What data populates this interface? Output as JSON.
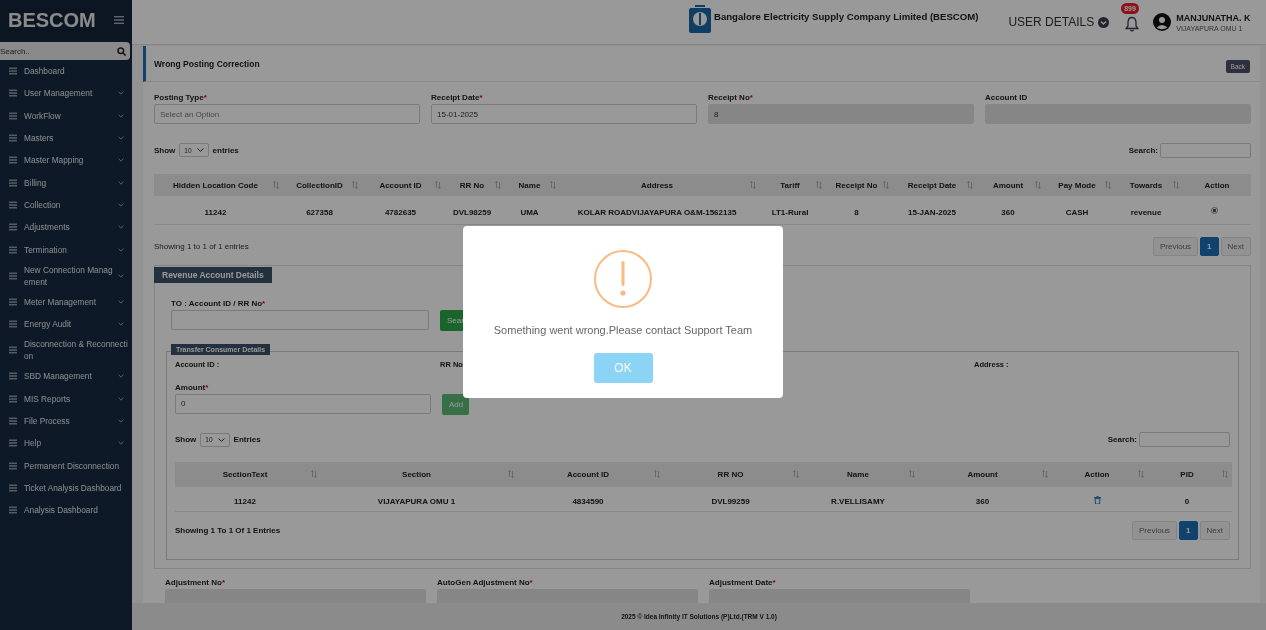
{
  "sidebar": {
    "brand": "BESCOM",
    "search": {
      "placeholder": "Search.."
    },
    "items": [
      {
        "label": "Dashboard",
        "expandable": false
      },
      {
        "label": "User Management",
        "expandable": true
      },
      {
        "label": "WorkFlow",
        "expandable": true
      },
      {
        "label": "Masters",
        "expandable": true
      },
      {
        "label": "Master Mapping",
        "expandable": true
      },
      {
        "label": "Billing",
        "expandable": true
      },
      {
        "label": "Collection",
        "expandable": true
      },
      {
        "label": "Adjustments",
        "expandable": true
      },
      {
        "label": "Termination",
        "expandable": true
      },
      {
        "label": "New Connection Management",
        "expandable": true
      },
      {
        "label": "Meter Management",
        "expandable": true
      },
      {
        "label": "Energy Audit",
        "expandable": true
      },
      {
        "label": "Disconnection & Reconnection",
        "expandable": false
      },
      {
        "label": "SBD Management",
        "expandable": true
      },
      {
        "label": "MIS Reports",
        "expandable": true
      },
      {
        "label": "File Process",
        "expandable": true
      },
      {
        "label": "Help",
        "expandable": true
      },
      {
        "label": "Permanent Disconnection",
        "expandable": false
      },
      {
        "label": "Ticket Analysis Dashboard",
        "expandable": false
      },
      {
        "label": "Analysis Dashboard",
        "expandable": false
      }
    ]
  },
  "header": {
    "company": "Bangalore Electricity Supply Company Limited (BESCOM)",
    "user_details": "USER DETAILS",
    "notification_count": "899",
    "user": {
      "name": "MANJUNATHA. K",
      "location": "VIJAYAPURA OMU 1"
    }
  },
  "page": {
    "title": "Wrong Posting Correction",
    "back_button": "Back",
    "fields": [
      {
        "label": "Posting Type",
        "required_mark": "*",
        "placeholder": "Select an Option",
        "disabled": false
      },
      {
        "label": "Receipt Date",
        "required_mark": "*",
        "value": "15-01-2025",
        "disabled": false
      },
      {
        "label": "Receipt No",
        "required_mark": "*",
        "value": "8",
        "disabled": true
      },
      {
        "label": "Account ID",
        "disabled": true
      }
    ],
    "receipts_table": {
      "length_menu": {
        "show": "Show",
        "value": "10",
        "entries": "entries"
      },
      "search_label": "Search:",
      "columns": [
        {
          "label": "Hidden Location Code",
          "sortable": true,
          "kind": "text"
        },
        {
          "label": "CollectionID",
          "sortable": true,
          "kind": "text"
        },
        {
          "label": "Account ID",
          "sortable": true,
          "kind": "text"
        },
        {
          "label": "RR No",
          "sortable": true,
          "kind": "text"
        },
        {
          "label": "Name",
          "sortable": true,
          "kind": "text"
        },
        {
          "label": "Address",
          "sortable": true,
          "kind": "text"
        },
        {
          "label": "Tariff",
          "sortable": true,
          "kind": "text"
        },
        {
          "label": "Receipt No",
          "sortable": true,
          "kind": "text"
        },
        {
          "label": "Receipt Date",
          "sortable": true,
          "kind": "text"
        },
        {
          "label": "Amount",
          "sortable": true,
          "kind": "text"
        },
        {
          "label": "Pay Mode",
          "sortable": true,
          "kind": "text"
        },
        {
          "label": "Towards",
          "sortable": true,
          "kind": "text"
        },
        {
          "label": "Action",
          "sortable": false,
          "kind": "action"
        }
      ],
      "rows": [
        {
          "cells": [
            "11242",
            "627358",
            "4782635",
            "DVL98259",
            "UMA",
            "KOLAR ROADVIJAYAPURA O&M-1562135",
            "LT1-Rural",
            "8",
            "15-JAN-2025",
            "360",
            "CASH",
            "revenue",
            ""
          ],
          "action": {
            "kind": "radio",
            "selected": true
          }
        }
      ],
      "info": "Showing 1 to 1 of 1 entries",
      "pagination": [
        {
          "label": "Previous",
          "selected": false,
          "disabled": true
        },
        {
          "label": "1",
          "selected": true,
          "disabled": false
        },
        {
          "label": "Next",
          "selected": false,
          "disabled": true
        }
      ]
    },
    "revenue": {
      "title": "Revenue Account Details",
      "to_field": {
        "label": "TO : Account ID / RR No",
        "required_mark": "*"
      },
      "search_button": "Sear",
      "transfer": {
        "title": "Transfer Consumer Details",
        "info": [
          {
            "label": "Account ID :"
          },
          {
            "label": "RR No"
          },
          {
            "label": "Address :"
          }
        ],
        "amount_field": {
          "label": "Amount",
          "required_mark": "*",
          "value": "0"
        },
        "add_button": "Add",
        "table": {
          "length_menu": {
            "show": "Show",
            "value": "10",
            "entries": "Entries"
          },
          "search_label": "Search:",
          "columns": [
            {
              "label": "SectionText",
              "sortable": true,
              "kind": "text"
            },
            {
              "label": "Section",
              "sortable": true,
              "kind": "text"
            },
            {
              "label": "Account ID",
              "sortable": true,
              "kind": "text"
            },
            {
              "label": "RR NO",
              "sortable": true,
              "kind": "text"
            },
            {
              "label": "Name",
              "sortable": true,
              "kind": "text"
            },
            {
              "label": "Amount",
              "sortable": true,
              "kind": "text"
            },
            {
              "label": "Action",
              "sortable": true,
              "kind": "action"
            },
            {
              "label": "PID",
              "sortable": true,
              "kind": "text"
            }
          ],
          "rows": [
            {
              "cells": [
                "11242",
                "VIJAYAPURA OMU 1",
                "4834590",
                "DVL99259",
                "R.VELLISAMY",
                "360",
                "",
                "0"
              ],
              "action": {
                "kind": "delete"
              }
            }
          ],
          "info": "Showing 1 To 1 Of 1 Entries",
          "pagination": [
            {
              "label": "Previous",
              "selected": false,
              "disabled": true
            },
            {
              "label": "1",
              "selected": true,
              "disabled": false
            },
            {
              "label": "Next",
              "selected": false,
              "disabled": true
            }
          ]
        }
      }
    },
    "adjustment_fields": [
      {
        "label": "Adjustment No",
        "required_mark": "*"
      },
      {
        "label": "AutoGen Adjustment No",
        "required_mark": "*"
      },
      {
        "label": "Adjustment Date",
        "required_mark": "*"
      }
    ]
  },
  "footer": "2025 © Idea Infinity IT Solutions (P)Ltd.(TRM V 1.0)",
  "modal": {
    "kind": "warning",
    "message": "Something went wrong.Please contact Support Team",
    "button": "OK"
  }
}
